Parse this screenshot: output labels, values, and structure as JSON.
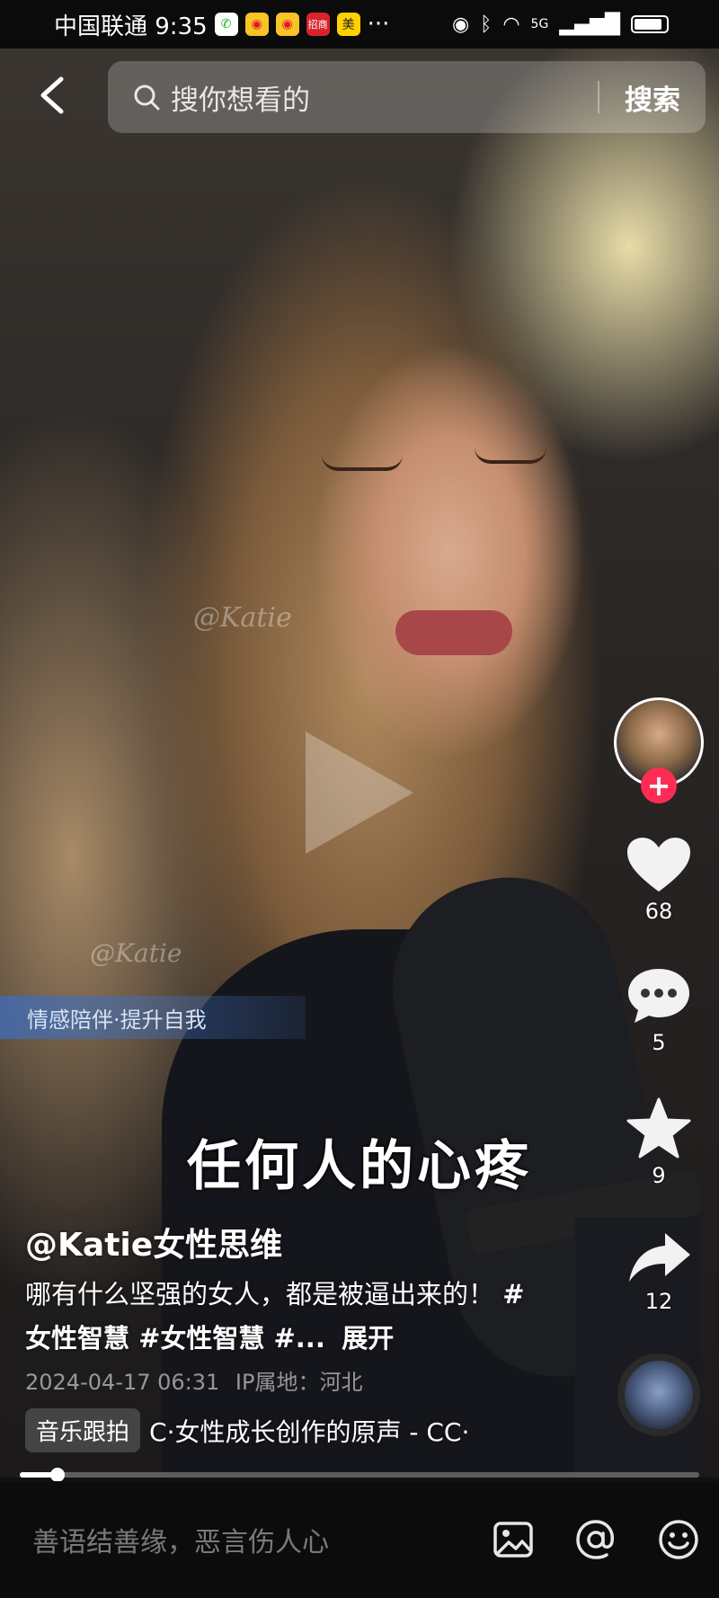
{
  "status_bar": {
    "carrier_time": "中国联通 9:35",
    "badge_bank": "招商",
    "badge_meituan": "美",
    "more": "···",
    "network": "5G"
  },
  "search": {
    "placeholder": "搜你想看的",
    "button_label": "搜索"
  },
  "video": {
    "watermark_1": "@Katie",
    "watermark_2": "@Katie",
    "overlay_caption": "情感陪伴·提升自我",
    "subtitle": "任何人的心疼"
  },
  "rail": {
    "follow_symbol": "+",
    "likes": "68",
    "comments": "5",
    "favorites": "9",
    "shares": "12"
  },
  "post": {
    "author": "@Katie女性思维",
    "desc_text": "哪有什么坚强的女人，都是被逼出来的！",
    "tags": "#女性智慧 #女性智慧 #...",
    "expand": "展开",
    "timestamp": "2024-04-17 06:31",
    "location": "IP属地：河北",
    "music_tag": "音乐跟拍",
    "music_text": "C·女性成长创作的原声 - CC·"
  },
  "playback": {
    "progress": 0.055
  },
  "bottom_bar": {
    "comment_placeholder": "善语结善缘，恶言伤人心"
  },
  "colors": {
    "accent": "#fe2c55",
    "overlay_blue": "#3c6ebe"
  },
  "icons": [
    "back-arrow-icon",
    "search-icon",
    "heart-icon",
    "comment-icon",
    "star-icon",
    "share-icon",
    "image-icon",
    "at-icon",
    "emoji-icon",
    "play-icon"
  ]
}
